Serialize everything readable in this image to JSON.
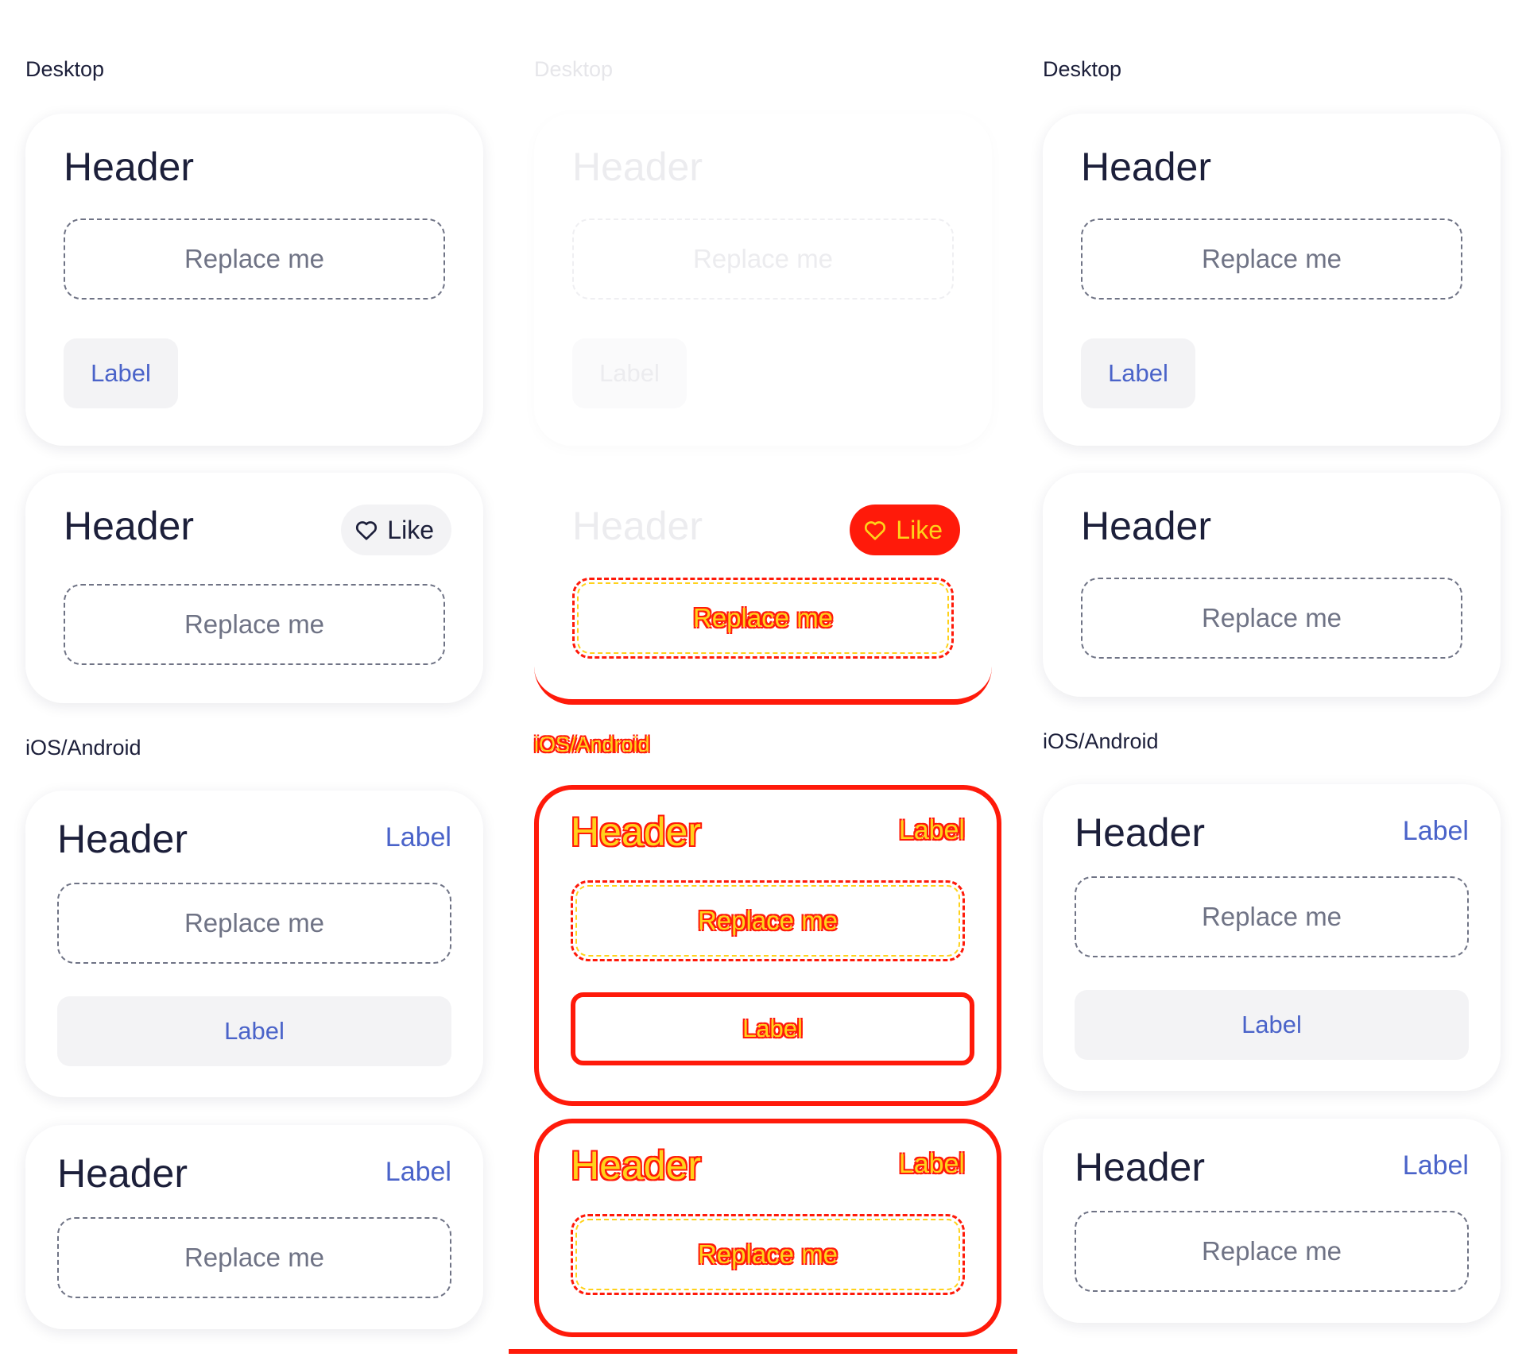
{
  "sections": {
    "desktop": "Desktop",
    "mobile": "iOS/Android"
  },
  "card": {
    "header": "Header",
    "placeholder": "Replace me",
    "label": "Label",
    "like": "Like"
  },
  "colors": {
    "text": "#1c1f3a",
    "accent": "#4a63c9",
    "muted": "#6f7385",
    "button_bg": "#f3f3f5",
    "diff_red": "#ff1a0a",
    "diff_yellow": "#ffd21a"
  },
  "icons": {
    "like": "heart-outline-icon"
  }
}
